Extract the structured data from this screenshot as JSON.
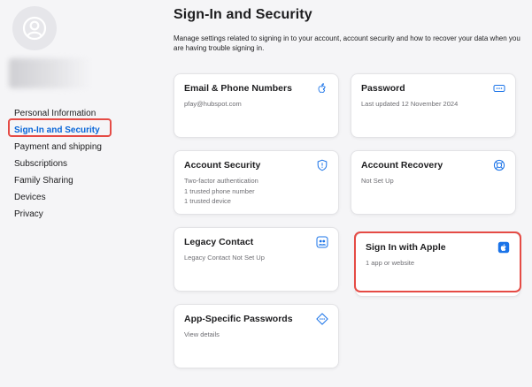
{
  "sidebar": {
    "items": [
      {
        "label": "Personal Information"
      },
      {
        "label": "Sign-In and Security"
      },
      {
        "label": "Payment and shipping"
      },
      {
        "label": "Subscriptions"
      },
      {
        "label": "Family Sharing"
      },
      {
        "label": "Devices"
      },
      {
        "label": "Privacy"
      }
    ],
    "active_item": "Sign-In and Security"
  },
  "main": {
    "title": "Sign-In and Security",
    "description": "Manage settings related to signing in to your account, account security and how to recover your data when you are having trouble signing in.",
    "cards": [
      {
        "title": "Email & Phone Numbers",
        "lines": [
          "pfay@hubspot.com"
        ],
        "icon": "apple-logo-icon"
      },
      {
        "title": "Password",
        "lines": [
          "Last updated 12 November 2024"
        ],
        "icon": "password-dots-icon"
      },
      {
        "title": "Account Security",
        "lines": [
          "Two-factor authentication",
          "1 trusted phone number",
          "1 trusted device"
        ],
        "icon": "shield-icon"
      },
      {
        "title": "Account Recovery",
        "lines": [
          "Not Set Up"
        ],
        "icon": "lifebuoy-icon"
      },
      {
        "title": "Legacy Contact",
        "lines": [
          "Legacy Contact Not Set Up"
        ],
        "icon": "people-icon"
      },
      {
        "title": "Sign In with Apple",
        "lines": [
          "1 app or website"
        ],
        "icon": "apple-square-icon"
      },
      {
        "title": "App-Specific Passwords",
        "lines": [
          "View details"
        ],
        "icon": "key-diamond-icon"
      }
    ]
  },
  "colors": {
    "accent": "#0a66d8",
    "icon_blue": "#1a73e8",
    "highlight": "#e54b45",
    "background": "#f5f5f7"
  }
}
